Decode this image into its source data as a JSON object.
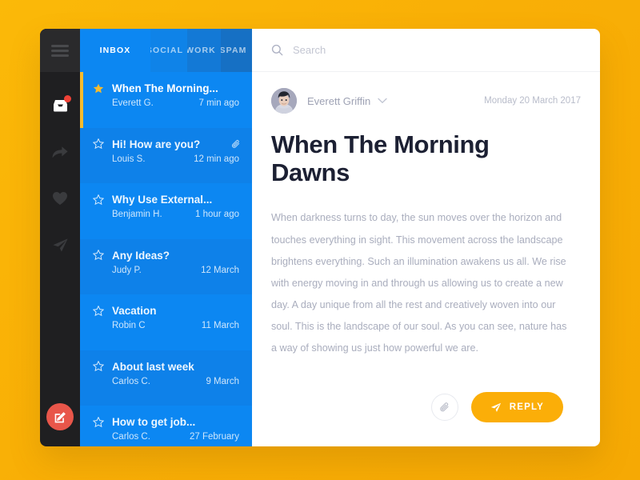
{
  "theme": {
    "page_background": "#F9AF06",
    "rail_background": "#1F1F21",
    "list_background": "#0C87F2",
    "accent_yellow": "#F6BB2E",
    "reply_button": "#FBAE08",
    "compose_button": "#E8564A",
    "badge_red": "#EF4136",
    "title_color": "#1C2033",
    "body_text_color": "#A9ADBD"
  },
  "rail": {
    "menu_icon": "hamburger-icon",
    "items": [
      {
        "icon": "inbox-icon",
        "label": "Inbox",
        "has_badge": true
      },
      {
        "icon": "forward-arrow-icon",
        "label": "Forward",
        "has_badge": false
      },
      {
        "icon": "heart-icon",
        "label": "Favorites",
        "has_badge": false
      },
      {
        "icon": "paper-plane-icon",
        "label": "Sent",
        "has_badge": false
      }
    ],
    "compose": {
      "icon": "compose-pencil-icon",
      "label": "Compose"
    }
  },
  "tabs": [
    {
      "label": "INBOX",
      "active": true
    },
    {
      "label": "SOCIAL",
      "active": false
    },
    {
      "label": "WORK",
      "active": false
    },
    {
      "label": "SPAM",
      "active": false
    }
  ],
  "search": {
    "placeholder": "Search",
    "value": "",
    "icon": "search-icon"
  },
  "mail_list": [
    {
      "subject": "When The Morning...",
      "sender": "Everett G.",
      "time": "7 min ago",
      "starred": true,
      "selected": true,
      "has_attachment": false
    },
    {
      "subject": "Hi! How are you?",
      "sender": "Louis S.",
      "time": "12 min ago",
      "starred": false,
      "selected": false,
      "has_attachment": true
    },
    {
      "subject": "Why Use External...",
      "sender": "Benjamin H.",
      "time": "1 hour ago",
      "starred": false,
      "selected": false,
      "has_attachment": false
    },
    {
      "subject": "Any Ideas?",
      "sender": "Judy P.",
      "time": "12 March",
      "starred": false,
      "selected": false,
      "has_attachment": false
    },
    {
      "subject": "Vacation",
      "sender": "Robin C",
      "time": "11 March",
      "starred": false,
      "selected": false,
      "has_attachment": false
    },
    {
      "subject": "About last week",
      "sender": "Carlos C.",
      "time": "9 March",
      "starred": false,
      "selected": false,
      "has_attachment": false
    },
    {
      "subject": "How to get job...",
      "sender": "Carlos C.",
      "time": "27 February",
      "starred": false,
      "selected": false,
      "has_attachment": false
    }
  ],
  "message": {
    "sender_name": "Everett Griffin",
    "date": "Monday 20 March 2017",
    "title": "When The Morning Dawns",
    "body": "When darkness turns to day, the sun moves over the horizon and touches everything in sight. This movement across the landscape brightens everything. Such an illumination awakens us all. We rise with energy moving in and through us allowing us to create a new day. A day unique from all the rest and creatively woven into our soul. This is the landscape of our soul. As you can see, nature has a way of showing us just how powerful we are.",
    "avatar_icon": "user-avatar",
    "dropdown_icon": "chevron-down-icon"
  },
  "actions": {
    "attach_label": "Attach",
    "attach_icon": "paperclip-icon",
    "reply_label": "REPLY",
    "reply_icon": "paper-plane-icon"
  }
}
